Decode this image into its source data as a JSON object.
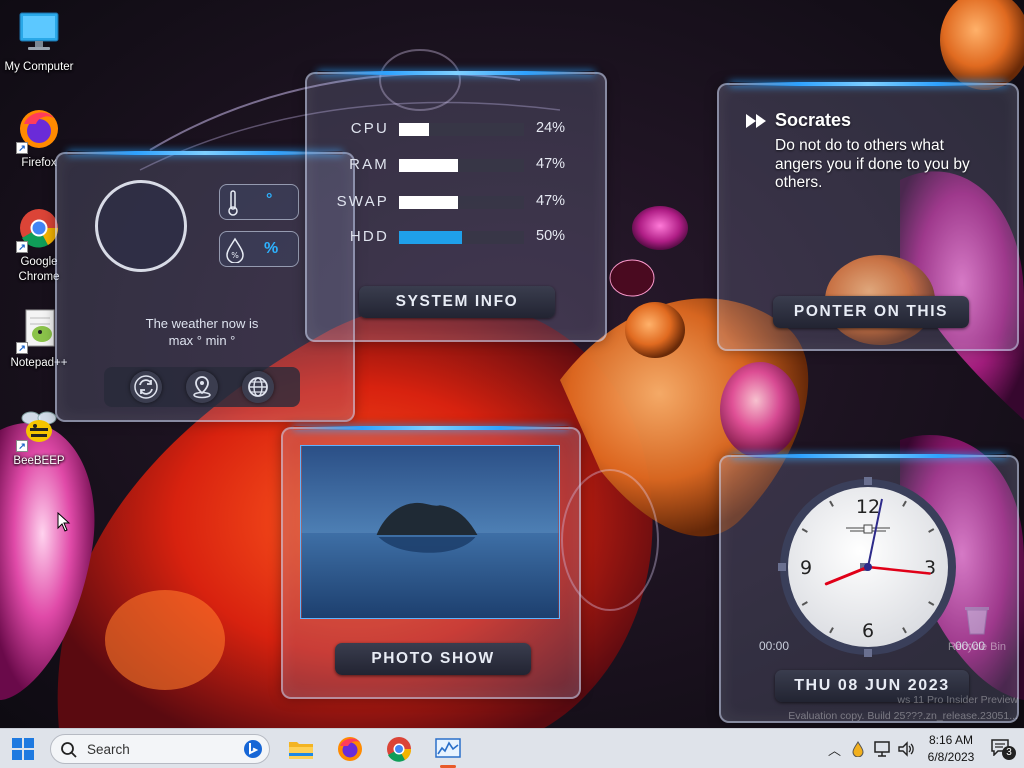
{
  "desktop": {
    "icons": [
      {
        "label": "My Computer",
        "icon": "computer-icon"
      },
      {
        "label": "Firefox",
        "icon": "firefox-icon"
      },
      {
        "label": "Google Chrome",
        "icon": "chrome-icon"
      },
      {
        "label": "Notepad++",
        "icon": "notepad-plus-plus-icon"
      },
      {
        "label": "BeeBEEP",
        "icon": "bee-icon"
      }
    ],
    "recycle_bin_label": "Recycle Bin",
    "watermark_line1": "ws 11 Pro Insider Preview",
    "watermark_line2": "Evaluation copy. Build 25???.zn_release.23051..."
  },
  "weather": {
    "temp_value": "°",
    "humidity_value": "%",
    "line1": "The weather now is",
    "line2": "max ° min °",
    "buttons": [
      "refresh-icon",
      "location-pin-icon",
      "globe-icon"
    ]
  },
  "system_info": {
    "title": "SYSTEM INFO",
    "rows": [
      {
        "name": "CPU",
        "percent": 24,
        "label": "24%",
        "color": "#ffffff"
      },
      {
        "name": "RAM",
        "percent": 47,
        "label": "47%",
        "color": "#ffffff"
      },
      {
        "name": "SWAP",
        "percent": 47,
        "label": "47%",
        "color": "#ffffff"
      },
      {
        "name": "HDD",
        "percent": 50,
        "label": "50%",
        "color": "#1fa0ea"
      }
    ]
  },
  "quote": {
    "author": "Socrates",
    "text": "Do not do to others what angers you if done to you by others.",
    "button": "PONTER ON THIS"
  },
  "photo": {
    "button": "PHOTO SHOW"
  },
  "clock": {
    "numerals": {
      "twelve": "12",
      "three": "3",
      "six": "6",
      "nine": "9"
    },
    "left_time": "00:00",
    "right_time": "00:00",
    "date": "THU 08 JUN 2023",
    "hour": 8,
    "minute": 16
  },
  "taskbar": {
    "search_placeholder": "Search",
    "time": "8:16 AM",
    "date": "6/8/2023",
    "notification_count": "3",
    "pinned": [
      "file-explorer-icon",
      "firefox-icon",
      "chrome-icon",
      "system-monitor-icon"
    ]
  }
}
